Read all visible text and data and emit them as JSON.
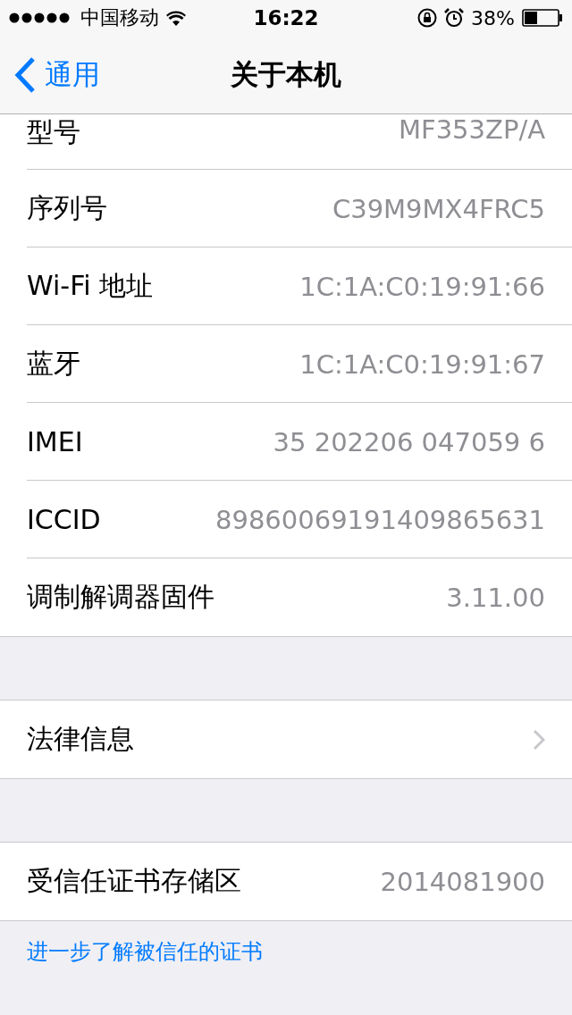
{
  "status_bar": {
    "carrier": "中国移动",
    "time": "16:22",
    "battery": "38%"
  },
  "nav": {
    "back": "通用",
    "title": "关于本机"
  },
  "groups": [
    {
      "rows": [
        {
          "label": "型号",
          "value": "MF353ZP/A",
          "kind": "value"
        },
        {
          "label": "序列号",
          "value": "C39M9MX4FRC5",
          "kind": "value"
        },
        {
          "label": "Wi-Fi 地址",
          "value": "1C:1A:C0:19:91:66",
          "kind": "value"
        },
        {
          "label": "蓝牙",
          "value": "1C:1A:C0:19:91:67",
          "kind": "value"
        },
        {
          "label": "IMEI",
          "value": "35 202206 047059 6",
          "kind": "value"
        },
        {
          "label": "ICCID",
          "value": "89860069191409865631",
          "kind": "value"
        },
        {
          "label": "调制解调器固件",
          "value": "3.11.00",
          "kind": "value"
        }
      ]
    },
    {
      "rows": [
        {
          "label": "法律信息",
          "kind": "link"
        }
      ]
    },
    {
      "rows": [
        {
          "label": "受信任证书存储区",
          "value": "2014081900",
          "kind": "value"
        }
      ]
    }
  ],
  "footer_link": "进一步了解被信任的证书"
}
